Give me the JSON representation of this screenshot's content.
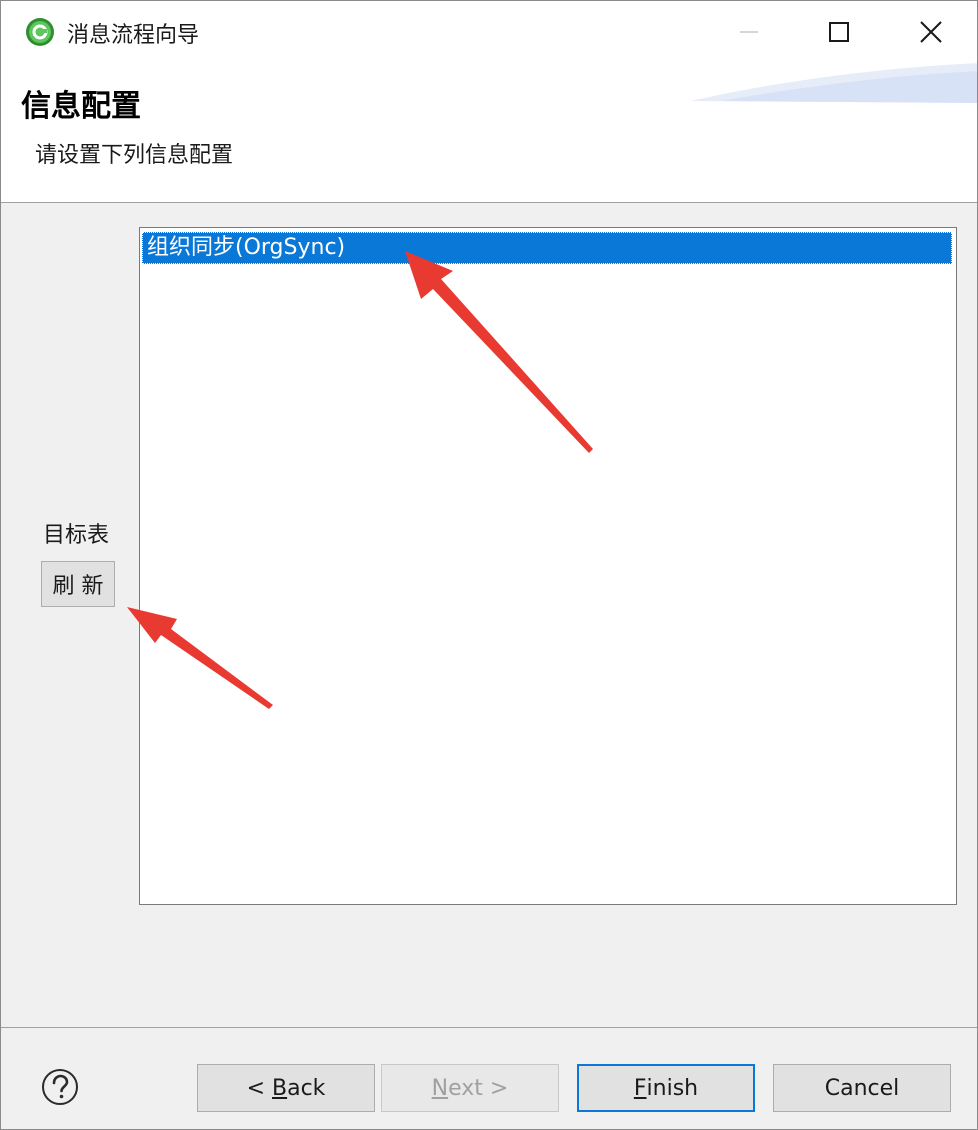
{
  "window": {
    "title": "消息流程向导"
  },
  "banner": {
    "title": "信息配置",
    "description": "请设置下列信息配置"
  },
  "content": {
    "left_label": "目标表",
    "refresh_label": "刷 新",
    "list": {
      "items": [
        {
          "label": "组织同步(OrgSync)",
          "selected": true
        }
      ]
    }
  },
  "footer": {
    "back": {
      "prefix": "< ",
      "mnemonic": "B",
      "rest": "ack"
    },
    "next": {
      "mnemonic": "N",
      "rest": "ext >"
    },
    "finish": {
      "mnemonic": "F",
      "rest": "inish"
    },
    "cancel": {
      "label": "Cancel"
    }
  },
  "colors": {
    "selection": "#0a78d7",
    "annotation_arrow": "#e83a30",
    "app_icon": "#3aa83a"
  },
  "icons": {
    "app": "green-circle-app-icon",
    "help": "question-mark-icon",
    "minimize": "minimize-icon",
    "maximize": "maximize-icon",
    "close": "close-icon"
  }
}
